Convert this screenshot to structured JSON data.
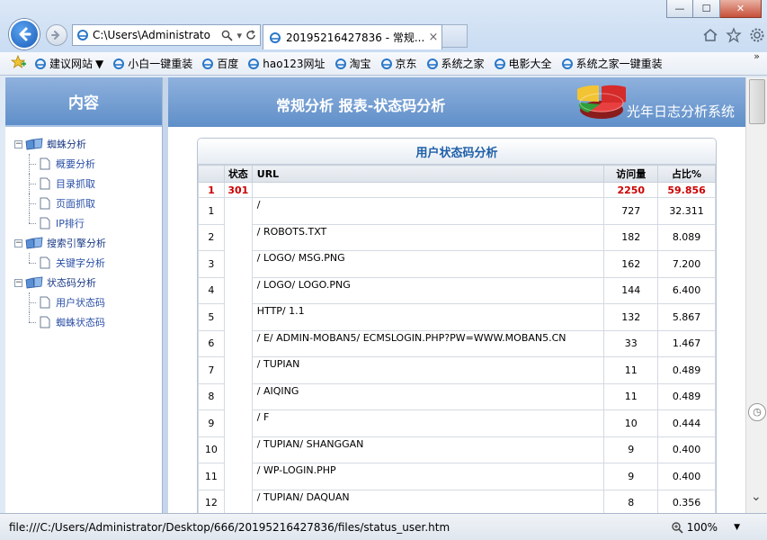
{
  "browser": {
    "address": "C:\\Users\\Administrato",
    "tab_title": "20195216427836 - 常规...",
    "tab_close": "×",
    "window_buttons": {
      "minimize": "—",
      "maximize": "☐",
      "close": "✕"
    }
  },
  "favorites": [
    "建议网站",
    "小白一键重装",
    "百度",
    "hao123网址",
    "淘宝",
    "京东",
    "系统之家",
    "电影大全",
    "系统之家一键重装"
  ],
  "sidebar": {
    "title": "内容",
    "groups": [
      {
        "label": "蜘蛛分析",
        "items": [
          "概要分析",
          "目录抓取",
          "页面抓取",
          "IP排行"
        ]
      },
      {
        "label": "搜索引擎分析",
        "items": [
          "关键字分析"
        ]
      },
      {
        "label": "状态码分析",
        "items": [
          "用户状态码",
          "蜘蛛状态码"
        ]
      }
    ]
  },
  "main": {
    "title": "常规分析 报表-状态码分析",
    "brand": "光年日志分析系统",
    "panel_title": "用户状态码分析",
    "columns": {
      "index": "",
      "status": "状态",
      "url": "URL",
      "visits": "访问量",
      "ratio": "占比%"
    },
    "summary": {
      "index": "1",
      "status": "301",
      "url": "",
      "visits": "2250",
      "ratio": "59.856"
    },
    "rows": [
      {
        "index": "1",
        "url": "/",
        "visits": "727",
        "ratio": "32.311"
      },
      {
        "index": "2",
        "url": "/ ROBOTS.TXT",
        "visits": "182",
        "ratio": "8.089"
      },
      {
        "index": "3",
        "url": "/ LOGO/ MSG.PNG",
        "visits": "162",
        "ratio": "7.200"
      },
      {
        "index": "4",
        "url": "/ LOGO/ LOGO.PNG",
        "visits": "144",
        "ratio": "6.400"
      },
      {
        "index": "5",
        "url": "HTTP/ 1.1",
        "visits": "132",
        "ratio": "5.867"
      },
      {
        "index": "6",
        "url": "/ E/ ADMIN-MOBAN5/ ECMSLOGIN.PHP?PW=WWW.MOBAN5.CN",
        "visits": "33",
        "ratio": "1.467"
      },
      {
        "index": "7",
        "url": "/ TUPIAN",
        "visits": "11",
        "ratio": "0.489"
      },
      {
        "index": "8",
        "url": "/ AIQING",
        "visits": "11",
        "ratio": "0.489"
      },
      {
        "index": "9",
        "url": "/ F",
        "visits": "10",
        "ratio": "0.444"
      },
      {
        "index": "10",
        "url": "/ TUPIAN/ SHANGGAN",
        "visits": "9",
        "ratio": "0.400"
      },
      {
        "index": "11",
        "url": "/ WP-LOGIN.PHP",
        "visits": "9",
        "ratio": "0.400"
      },
      {
        "index": "12",
        "url": "/ TUPIAN/ DAQUAN",
        "visits": "8",
        "ratio": "0.356"
      }
    ]
  },
  "statusbar": {
    "url": "file:///C:/Users/Administrator/Desktop/666/20195216427836/files/status_user.htm",
    "zoom": "100%"
  }
}
